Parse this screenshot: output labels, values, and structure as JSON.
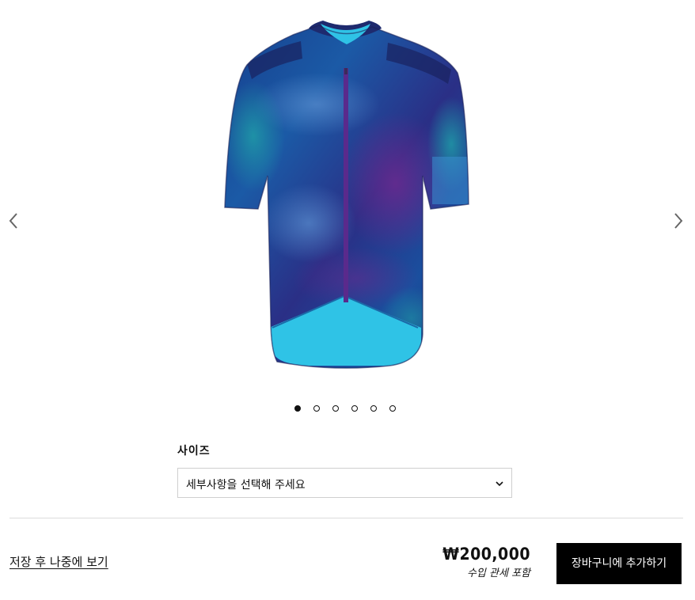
{
  "gallery": {
    "image_alt": "",
    "slide_count": 6,
    "active_slide": 1,
    "prev_icon": "chevron-left-icon",
    "next_icon": "chevron-right-icon"
  },
  "size": {
    "label": "사이즈",
    "placeholder": "세부사항을 선택해 주세요",
    "dropdown_icon": "chevron-down-icon"
  },
  "footer": {
    "save_later": "저장 후 나중에 보기",
    "price": "₩200,000",
    "tax_note": "수입 관세 포함",
    "add_to_cart": "장바구니에 추가하기"
  },
  "colors": {
    "button_bg": "#000000",
    "button_text": "#ffffff",
    "jersey_navy": "#1a2a7a",
    "jersey_cyan": "#2fc3e6"
  }
}
